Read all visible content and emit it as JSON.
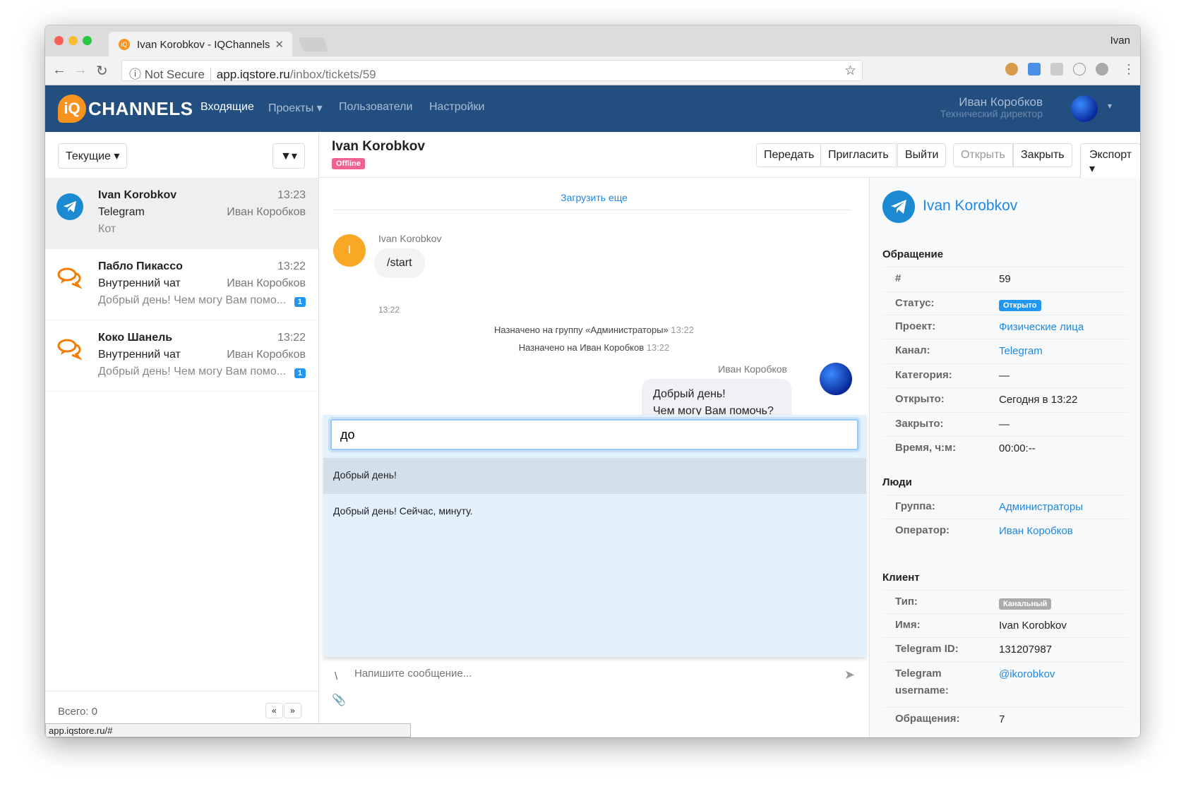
{
  "browser": {
    "tab_title": "Ivan Korobkov - IQChannels",
    "profile": "Ivan",
    "not_secure": "Not Secure",
    "url_host": "app.iqstore.ru",
    "url_path": "/inbox/tickets/59",
    "status_url": "app.iqstore.ru/#"
  },
  "nav": {
    "logo": "CHANNELS",
    "items": [
      "Входящие",
      "Проекты",
      "Пользователи",
      "Настройки"
    ],
    "user_name": "Иван Коробков",
    "user_role": "Технический директор"
  },
  "inbox": {
    "filter_label": "Текущие",
    "total": "Всего: 0",
    "prev": "«",
    "next": "»",
    "items": [
      {
        "name": "Ivan Korobkov",
        "time": "13:23",
        "channel": "Telegram",
        "operator": "Иван Коробков",
        "preview": "Кот",
        "badge": null,
        "icon": "telegram-icon"
      },
      {
        "name": "Пабло Пикассо",
        "time": "13:22",
        "channel": "Внутренний чат",
        "operator": "Иван Коробков",
        "preview": "Добрый день! Чем могу Вам помо...",
        "badge": "1",
        "icon": "chat-bubbles-icon"
      },
      {
        "name": "Коко Шанель",
        "time": "13:22",
        "channel": "Внутренний чат",
        "operator": "Иван Коробков",
        "preview": "Добрый день! Чем могу Вам помо...",
        "badge": "1",
        "icon": "chat-bubbles-icon"
      }
    ]
  },
  "chat": {
    "title": "Ivan Korobkov",
    "presence": "Offline",
    "buttons": {
      "transfer": "Передать",
      "invite": "Пригласить",
      "leave": "Выйти",
      "open": "Открыть",
      "close": "Закрыть",
      "export": "Экспорт"
    },
    "load_more": "Загрузить еще",
    "messages": [
      {
        "author": "Ivan Korobkov",
        "avatar_letter": "I",
        "text": "/start",
        "time": "13:22"
      },
      {
        "system": "Назначено на группу «Администраторы»",
        "time": "13:22"
      },
      {
        "system": "Назначено на Иван Коробков",
        "time": "13:22"
      },
      {
        "author": "Иван Коробков",
        "lines": [
          "Добрый день!",
          "Чем могу Вам помочь?"
        ]
      }
    ],
    "autocomplete": {
      "query": "до",
      "suggestions": [
        "Добрый день!",
        "Добрый день! Сейчас, минуту."
      ]
    },
    "composer": {
      "prefix": "\\",
      "placeholder": "Напишите сообщение..."
    }
  },
  "details": {
    "client_title": "Ivan Korobkov",
    "ticket_section": "Обращение",
    "ticket": [
      {
        "k": "#",
        "v": "59"
      },
      {
        "k": "Статус:",
        "v": "Открыто",
        "type": "label",
        "color": "#2196f3"
      },
      {
        "k": "Проект:",
        "v": "Физические лица",
        "type": "link"
      },
      {
        "k": "Канал:",
        "v": "Telegram",
        "type": "link"
      },
      {
        "k": "Категория:",
        "v": "—"
      },
      {
        "k": "Открыто:",
        "v": "Сегодня в 13:22"
      },
      {
        "k": "Закрыто:",
        "v": "—"
      },
      {
        "k": "Время, ч:м:",
        "v": "00:00:--"
      }
    ],
    "people_section": "Люди",
    "people": [
      {
        "k": "Группа:",
        "v": "Администраторы",
        "type": "link"
      },
      {
        "k": "Оператор:",
        "v": "Иван Коробков",
        "type": "link"
      }
    ],
    "client_section": "Клиент",
    "client": [
      {
        "k": "Тип:",
        "v": "Канальный",
        "type": "label",
        "color": "#aaaaaa"
      },
      {
        "k": "Имя:",
        "v": "Ivan Korobkov"
      },
      {
        "k": "Telegram ID:",
        "v": "131207987"
      },
      {
        "k": "Telegram username:",
        "v": "@ikorobkov",
        "type": "link"
      },
      {
        "k": "Обращения:",
        "v": "7"
      }
    ]
  },
  "colors": {
    "nav": "#234f80",
    "accent": "#1e88e5",
    "brand": "#f7931e",
    "offline": "#f06292"
  }
}
